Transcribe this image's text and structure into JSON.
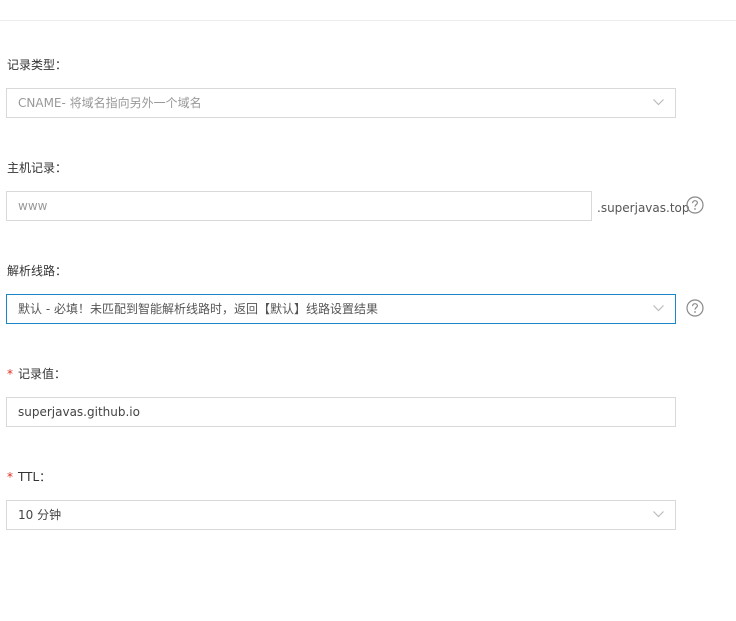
{
  "record_type": {
    "label": "记录类型：",
    "value": "CNAME- 将域名指向另外一个域名"
  },
  "host_record": {
    "label": "主机记录：",
    "placeholder": "www",
    "suffix": ".superjavas.top"
  },
  "resolve_line": {
    "label": "解析线路：",
    "value": "默认 - 必填！未匹配到智能解析线路时，返回【默认】线路设置结果"
  },
  "record_value": {
    "required_mark": "*",
    "label": "记录值：",
    "value": "superjavas.github.io"
  },
  "ttl": {
    "required_mark": "*",
    "label": "TTL：",
    "value": "10 分钟"
  },
  "icons": {
    "dropdown": "chevron-down-icon",
    "help": "question-circle-icon"
  },
  "colors": {
    "focus_border": "#1a86c7",
    "required": "#e0301e",
    "border": "#d9d9d9"
  }
}
